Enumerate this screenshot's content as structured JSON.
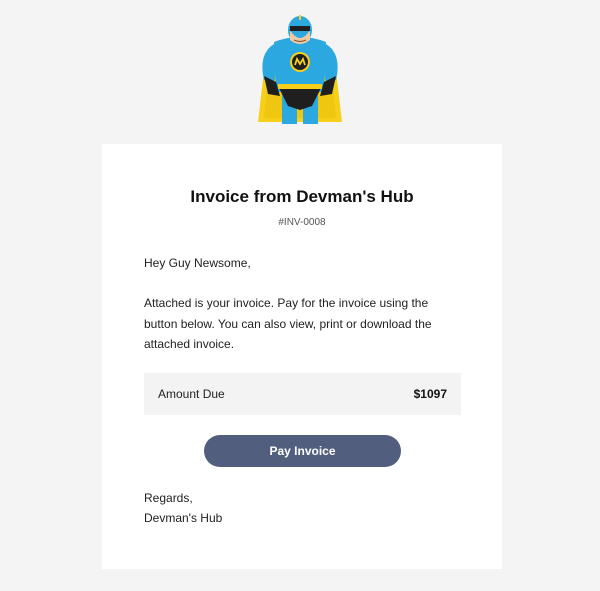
{
  "header": {
    "mascot_icon": "superhero-mascot-icon",
    "colors": {
      "suit": "#2aa8df",
      "cape": "#f6cf1a",
      "dark": "#1f1f1f"
    }
  },
  "invoice": {
    "title": "Invoice from Devman's Hub",
    "number": "#INV-0008",
    "greeting": "Hey Guy Newsome,",
    "message_lines": [
      "Attached is your invoice. Pay for the invoice using the",
      "button below. You can also view, print or download the",
      "attached invoice."
    ],
    "amount_label": "Amount Due",
    "amount_value": "$1097",
    "pay_button_label": "Pay Invoice",
    "regards_line1": "Regards,",
    "regards_line2": "Devman's Hub"
  },
  "theme": {
    "background": "#f4f4f4",
    "card": "#ffffff",
    "button": "#525e7e"
  }
}
